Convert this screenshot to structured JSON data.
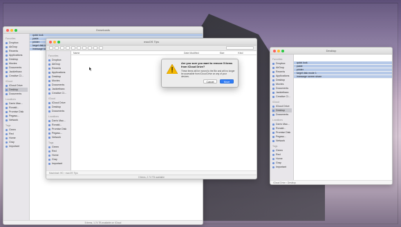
{
  "back_window": {
    "title": "Downloads",
    "sidebar": {
      "favorites_head": "Favorites",
      "favorites": [
        "Dropbox",
        "AirDrop",
        "Recents",
        "Applications",
        "Desktop",
        "Movies",
        "Documents",
        "Jackiethara",
        "Creative Cl..."
      ],
      "icloud_head": "iCloud",
      "icloud": [
        "iCloud Drive",
        "Desktop",
        "Documents"
      ],
      "locations_head": "Locations",
      "locations": [
        "Dan's Mac...",
        "Ronald...",
        "Promise Disk",
        "Pegasu...",
        "Network"
      ],
      "tags_head": "Tags",
      "tags": [
        "Green",
        "Red",
        "Home",
        "Gray",
        "Important"
      ]
    },
    "files": [
      "quick look",
      "paste",
      "printer",
      "target disk mode 1",
      "imessage screen share"
    ]
  },
  "mid_window": {
    "title": "macOS Tips",
    "columns": [
      "Name",
      "Date Modified",
      "Size",
      "Kind"
    ],
    "sidebar": {
      "favorites_head": "Favorites",
      "favorites": [
        "Dropbox",
        "AirDrop",
        "Recents",
        "Applications",
        "Desktop",
        "Movies",
        "Documents",
        "Jackiethara",
        "Creative Cl..."
      ],
      "icloud_head": "iCloud",
      "icloud": [
        "iCloud Drive",
        "Desktop",
        "Documents"
      ],
      "locations_head": "Locations",
      "locations": [
        "Dan's Mac...",
        "Ronald...",
        "Promise Disk",
        "Pegasu...",
        "Network"
      ],
      "tags_head": "Tags",
      "tags": [
        "Green",
        "Red",
        "Home",
        "Gray",
        "Important"
      ]
    },
    "path": "Macintosh HD › macOS Tips",
    "status": "0 items, 2.74 TB available"
  },
  "right_window": {
    "title": "Desktop",
    "sidebar": {
      "favorites_head": "Favorites",
      "favorites": [
        "Dropbox",
        "AirDrop",
        "Recents",
        "Applications",
        "Desktop",
        "Movies",
        "Documents",
        "Jackiethara",
        "Creative Cl..."
      ],
      "icloud_head": "iCloud",
      "icloud": [
        "iCloud Drive",
        "Desktop",
        "Documents"
      ],
      "locations_head": "Locations",
      "locations": [
        "Dan's Mac...",
        "Ronald...",
        "Promise Disk",
        "Pegasu...",
        "Network"
      ],
      "tags_head": "Tags",
      "tags": [
        "Green",
        "Red",
        "Home",
        "Gray",
        "Important"
      ]
    },
    "files": [
      "quick look",
      "paste",
      "printer",
      "target disk mode 1",
      "imessage screen share"
    ],
    "path": "iCloud Drive › Desktop"
  },
  "bottom_status": "5 items, 1.74 TB available on iCloud",
  "dialog": {
    "title": "Are you sure you want to remove 5 items from iCloud Drive?",
    "body": "These items will be moved to the Bin and will no longer be accessible from iCloud Drive on any of your devices.",
    "cancel": "Cancel",
    "confirm": "Move"
  },
  "colors": {
    "accent": "#2f7cf6",
    "red": "#ff5f57",
    "yellow": "#febc2e",
    "green": "#28c840"
  }
}
